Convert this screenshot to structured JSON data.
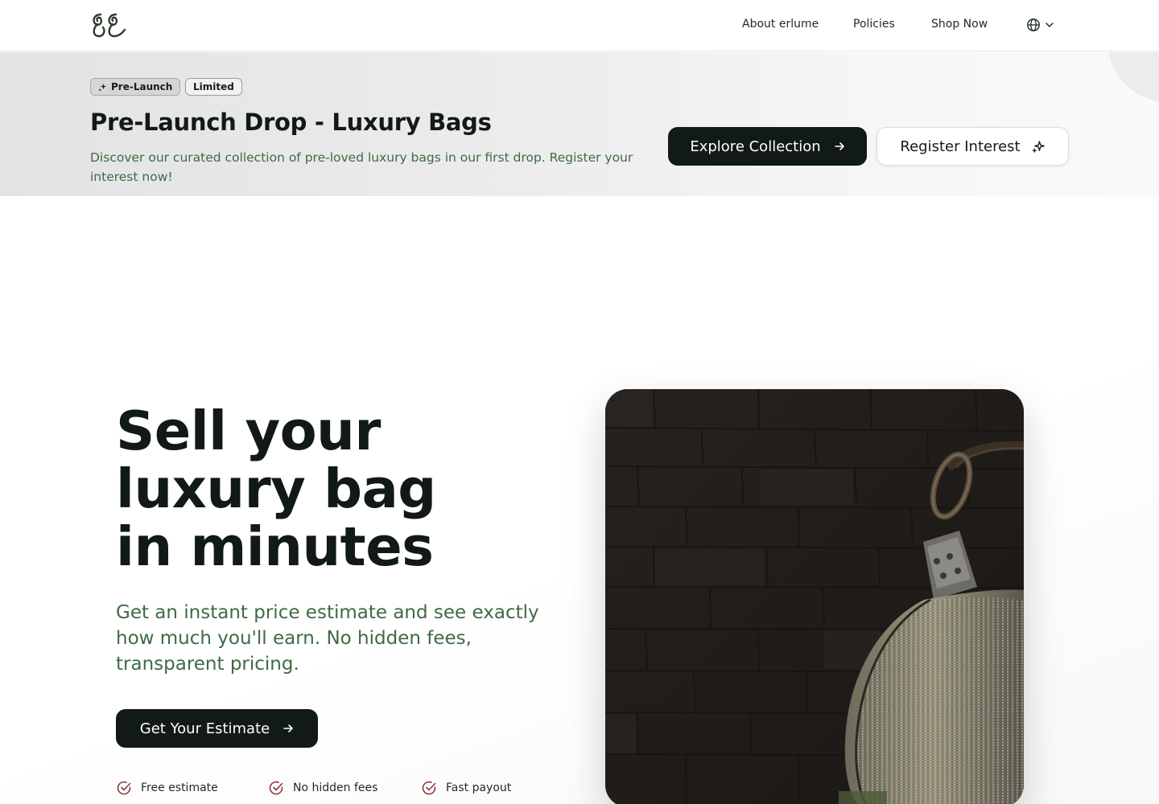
{
  "nav": {
    "logo_icon": "erlume-monogram-logo",
    "links": [
      "About erlume",
      "Policies",
      "Shop Now"
    ],
    "language_icon": "globe-icon"
  },
  "banner": {
    "badges": [
      "Pre-Launch",
      "Limited"
    ],
    "title": "Pre-Launch Drop - Luxury Bags",
    "description": "Discover our curated collection of pre-loved luxury bags in our first drop. Register your interest now!",
    "explore_label": "Explore Collection",
    "register_label": "Register Interest"
  },
  "hero": {
    "title_lines": [
      "Sell your",
      "luxury bag",
      "in minutes"
    ],
    "subtitle": "Get an instant price estimate and see exactly how much you'll earn. No hidden fees, transparent pricing.",
    "cta_label": "Get Your Estimate",
    "features": [
      "Free estimate",
      "No hidden fees",
      "Fast payout"
    ],
    "image_icon": "luxury-bag-photo"
  },
  "colors": {
    "primary": "#111a15",
    "accent_green": "#3f6a44",
    "check_red": "#8a3b3b"
  }
}
